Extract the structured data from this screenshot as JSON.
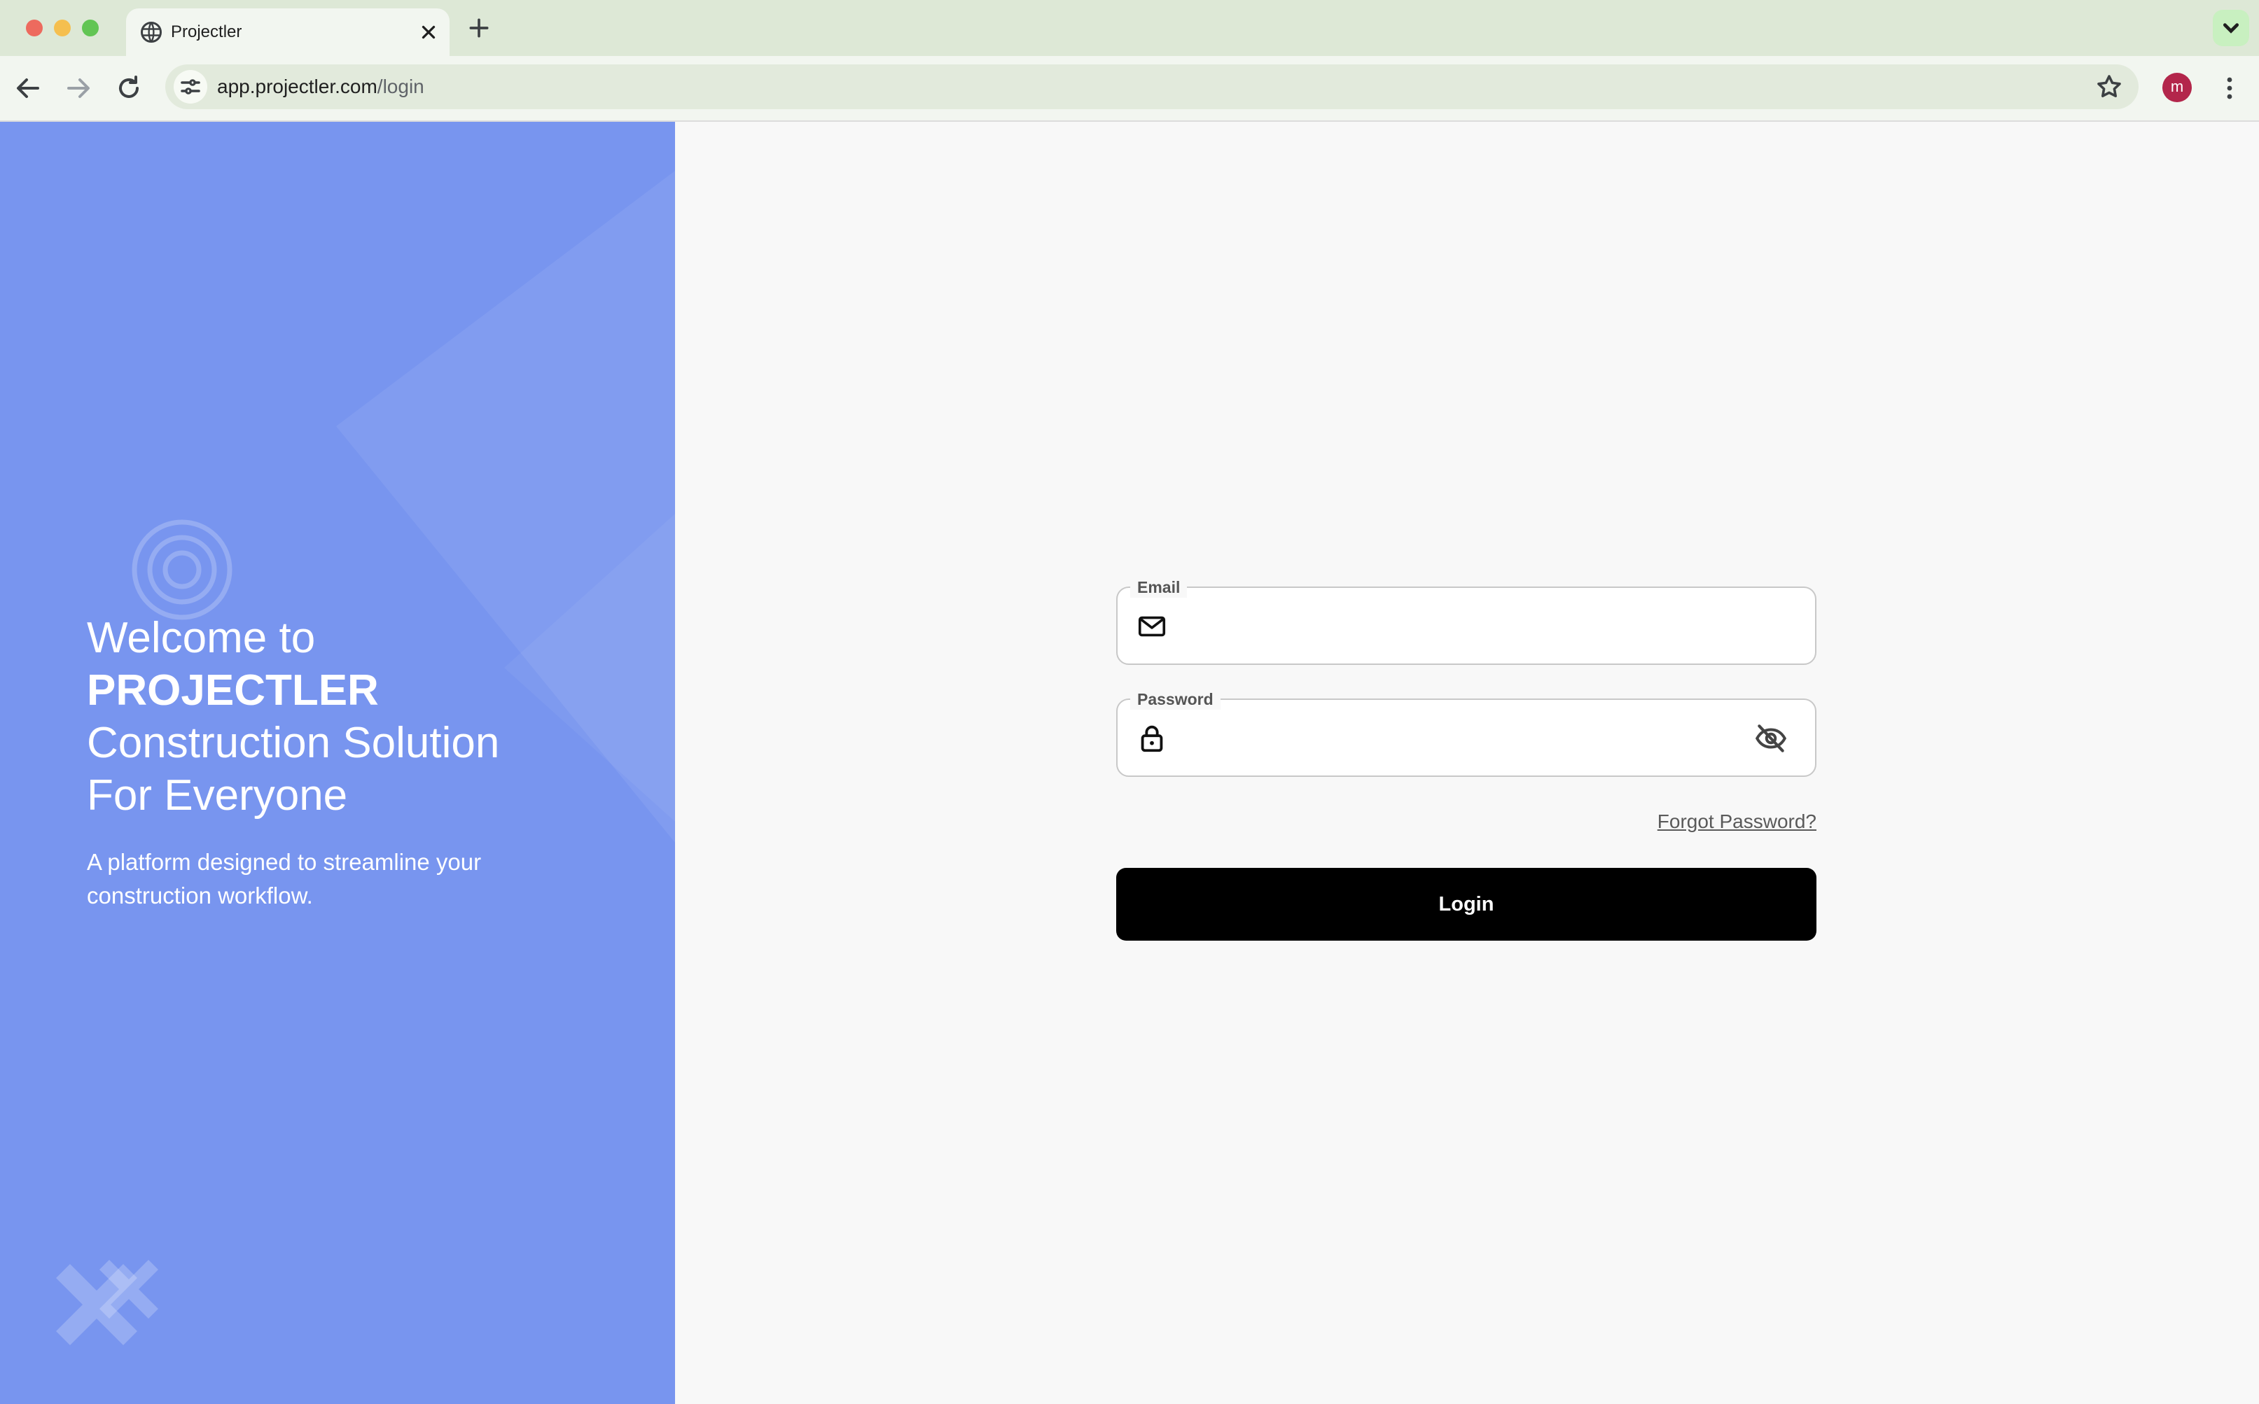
{
  "browser": {
    "tab_title": "Projectler",
    "url_host": "app.projectler.com",
    "url_path": "/login",
    "profile_initial": "m"
  },
  "hero": {
    "title_line1": "Welcome to",
    "brand": "PROJECTLER",
    "title_line3": "Construction Solution",
    "title_line4": "For Everyone",
    "subtitle": "A platform designed to streamline your construction workflow."
  },
  "login": {
    "email_label": "Email",
    "email_value": "",
    "password_label": "Password",
    "password_value": "",
    "forgot_label": "Forgot Password?",
    "submit_label": "Login"
  },
  "colors": {
    "hero_bg": "#7895ef",
    "button_bg": "#000000",
    "avatar_bg": "#b3264b",
    "tabbar_bg": "#dde8d6"
  },
  "icons": {
    "tab": "globe-icon",
    "email": "mail-icon",
    "password": "lock-icon",
    "visibility": "eye-off-icon"
  }
}
